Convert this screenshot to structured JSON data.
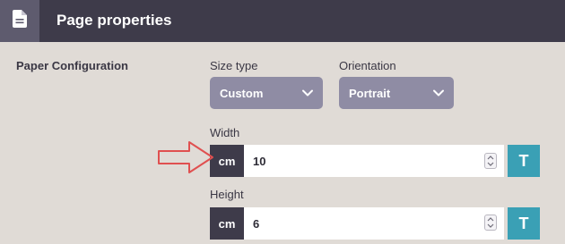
{
  "header": {
    "title": "Page properties",
    "icon": "document-icon"
  },
  "section": {
    "label": "Paper Configuration"
  },
  "size_type": {
    "label": "Size type",
    "value": "Custom"
  },
  "orientation": {
    "label": "Orientation",
    "value": "Portrait"
  },
  "width": {
    "label": "Width",
    "unit": "cm",
    "value": "10",
    "button": "T"
  },
  "height": {
    "label": "Height",
    "unit": "cm",
    "value": "6",
    "button": "T"
  },
  "colors": {
    "header_bg": "#3e3b4a",
    "select_bg": "#8f8ca4",
    "accent": "#3aa0b5",
    "annotation_arrow": "#e05050"
  }
}
